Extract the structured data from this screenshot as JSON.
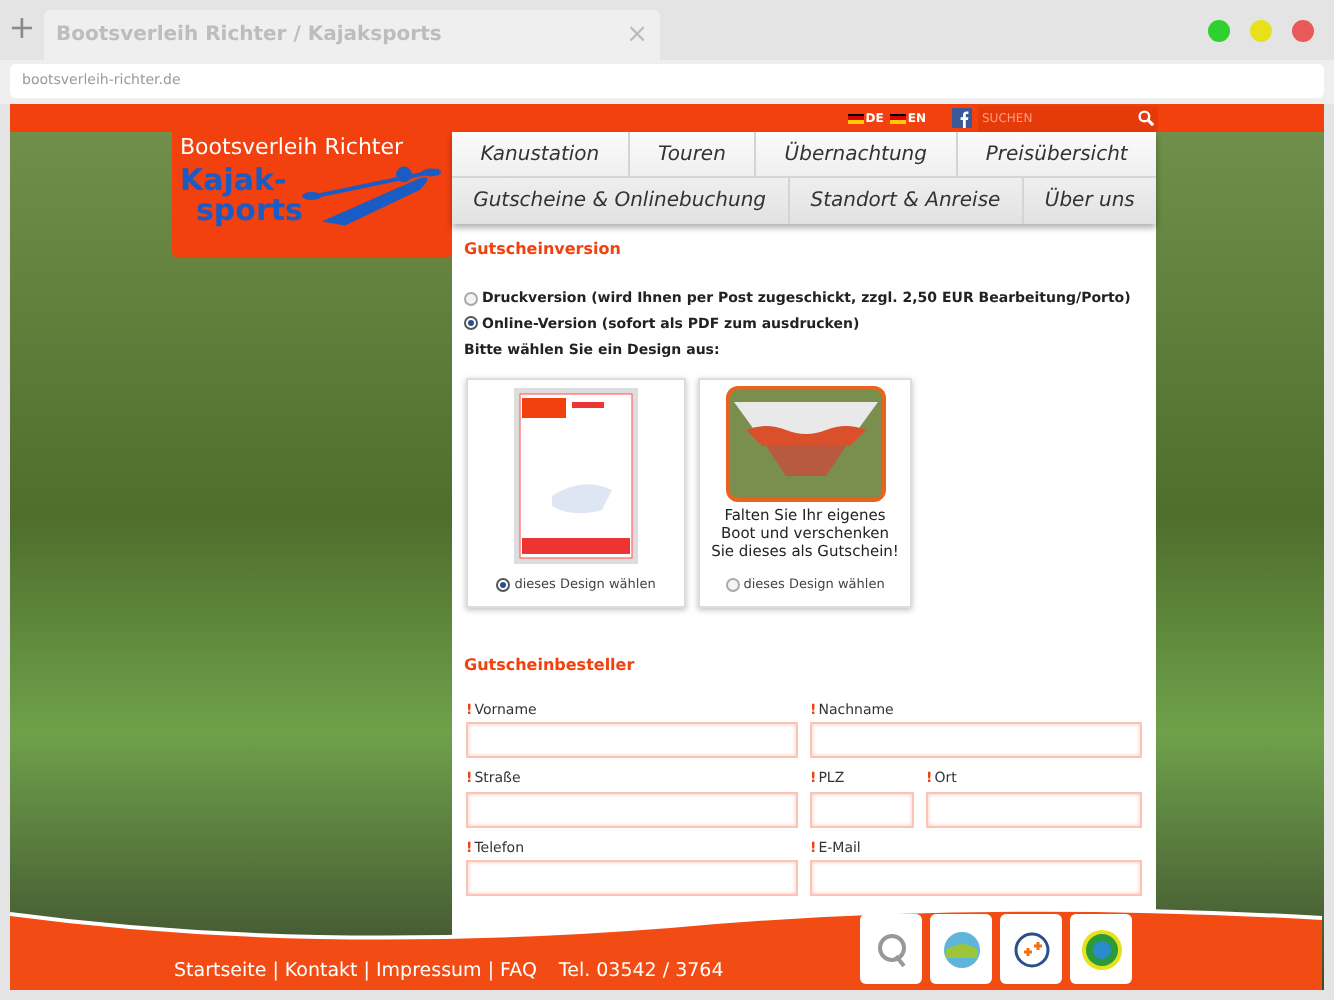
{
  "browser": {
    "tab_title": "Bootsverleih Richter / Kajaksports",
    "tab_close": "×",
    "new_tab": "+",
    "url": "bootsverleih-richter.de"
  },
  "topbar": {
    "languages": [
      {
        "label": "DE"
      },
      {
        "label": "EN"
      }
    ],
    "search": {
      "placeholder": "SUCHEN"
    }
  },
  "logo": {
    "title": "Bootsverleih Richter",
    "line_1": "Kajak-",
    "line_2": "sports"
  },
  "nav": {
    "row_1": [
      {
        "label": "Kanustation"
      },
      {
        "label": "Touren"
      },
      {
        "label": "Übernachtung"
      },
      {
        "label": "Preisübersicht"
      }
    ],
    "row_2": [
      {
        "label": "Gutscheine & Onlinebuchung"
      },
      {
        "label": "Standort & Anreise"
      },
      {
        "label": "Über uns"
      }
    ]
  },
  "voucher_version": {
    "heading": "Gutscheinversion",
    "options": [
      {
        "label": "Druckversion (wird Ihnen per Post zugeschickt, zzgl. 2,50 EUR Bearbeitung/Porto)",
        "selected": false
      },
      {
        "label": "Online-Version (sofort als PDF zum ausdrucken)",
        "selected": true
      }
    ],
    "prompt": "Bitte wählen Sie ein Design aus:",
    "designs": [
      {
        "kind": "sheet",
        "choice": "dieses Design wählen",
        "selected": true
      },
      {
        "kind": "boat",
        "caption": "Falten Sie Ihr eigenes Boot und verschenken Sie dieses als Gutschein!",
        "choice": "dieses Design wählen",
        "selected": false
      }
    ]
  },
  "orderer": {
    "heading": "Gutscheinbesteller",
    "required_mark": "!",
    "rows": [
      [
        {
          "label": "Vorname"
        },
        {
          "label": "Nachname"
        }
      ],
      [
        {
          "label": "Straße"
        },
        {
          "label": "PLZ"
        },
        {
          "label": "Ort"
        }
      ],
      [
        {
          "label": "Telefon"
        },
        {
          "label": "E-Mail"
        }
      ]
    ]
  },
  "footer": {
    "links": [
      "Startseite",
      "Kontakt",
      "Impressum",
      "FAQ"
    ],
    "separator": "|",
    "phone": "Tel. 03542 / 3764"
  }
}
